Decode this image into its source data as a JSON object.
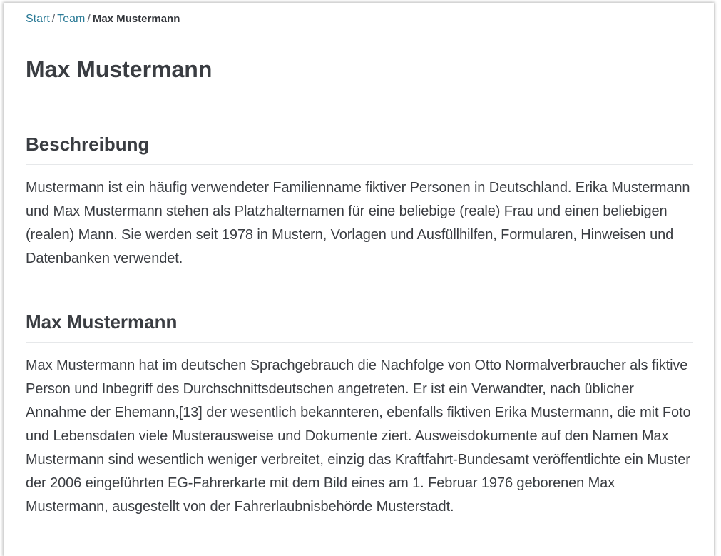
{
  "breadcrumb": {
    "items": [
      {
        "label": "Start"
      },
      {
        "label": "Team"
      }
    ],
    "separator": "/",
    "current": "Max Mustermann"
  },
  "page": {
    "title": "Max Mustermann"
  },
  "sections": [
    {
      "heading": "Beschreibung",
      "text": "Mustermann ist ein häufig verwendeter Familienname fiktiver Personen in Deutschland. Erika Mustermann und Max Mustermann stehen als Platzhalternamen für eine beliebige (reale) Frau und einen beliebigen (realen) Mann. Sie werden seit 1978 in Mustern, Vorlagen und Ausfüllhilfen, Formularen, Hinweisen und Datenbanken verwendet."
    },
    {
      "heading": "Max Mustermann",
      "text": "Max Mustermann hat im deutschen Sprachgebrauch die Nachfolge von Otto Normalverbraucher als fiktive Person und Inbegriff des Durchschnittsdeutschen angetreten. Er ist ein Verwandter, nach üblicher Annahme der Ehemann,[13] der wesentlich bekannteren, ebenfalls fiktiven Erika Mustermann, die mit Foto und Lebensdaten viele Musterausweise und Dokumente ziert. Ausweisdokumente auf den Namen Max Mustermann sind wesentlich weniger verbreitet, einzig das Kraftfahrt-Bundesamt veröffentlichte ein Muster der 2006 eingeführten EG-Fahrerkarte mit dem Bild eines am 1. Februar 1976 geborenen Max Mustermann, ausgestellt von der Fahrerlaubnisbehörde Musterstadt."
    }
  ],
  "colors": {
    "link": "#2a7a96",
    "text": "#3a3d42",
    "rule": "#e6e8ea"
  }
}
